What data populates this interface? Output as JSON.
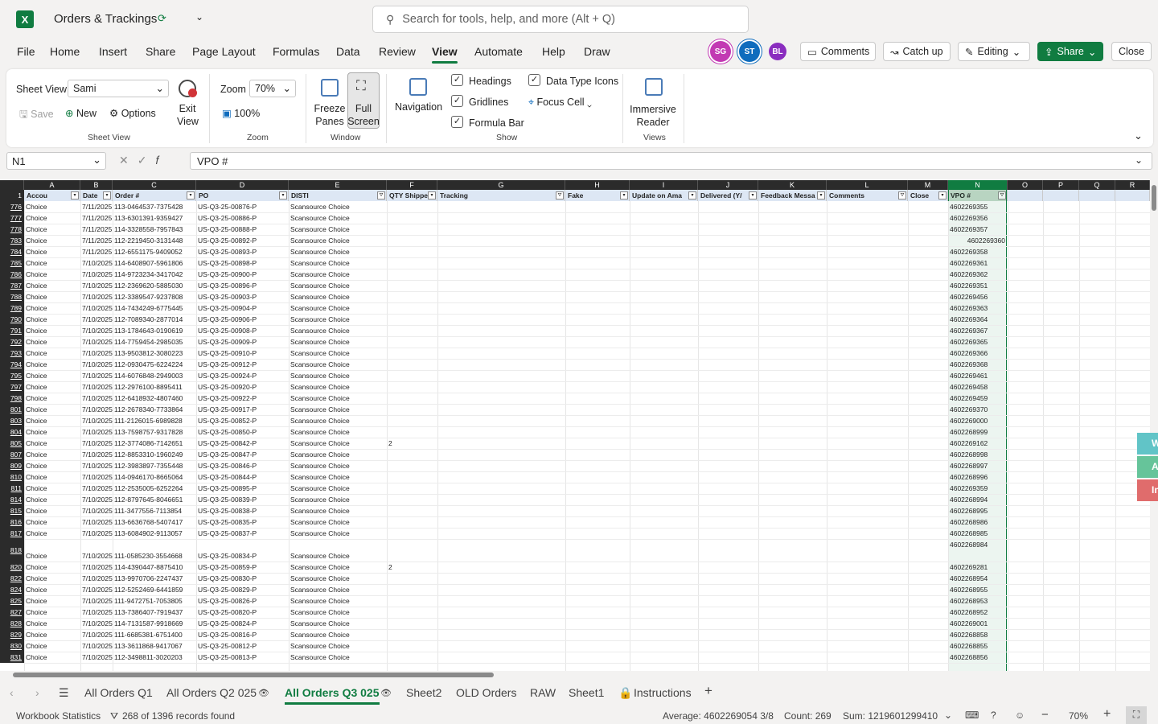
{
  "app": {
    "title": "Orders & Trackings",
    "search_placeholder": "Search for tools, help, and more (Alt + Q)",
    "logo": "X",
    "brand_color": "#107c41"
  },
  "menu": [
    "File",
    "Home",
    "Insert",
    "Share",
    "Page Layout",
    "Formulas",
    "Data",
    "Review",
    "View",
    "Automate",
    "Help",
    "Draw"
  ],
  "menu_active": "View",
  "avatars": [
    {
      "initials": "SG",
      "color": "#c239b3"
    },
    {
      "initials": "ST",
      "color": "#0f6cbd"
    },
    {
      "initials": "BL",
      "color": "#8a2dbf"
    }
  ],
  "top_buttons": {
    "comments": "Comments",
    "catchup": "Catch up",
    "editing": "Editing",
    "share": "Share",
    "close": "Close"
  },
  "ribbon": {
    "sheet_view_label": "Sheet View",
    "sheet_view_value": "Sami",
    "save": "Save",
    "new": "New",
    "options": "Options",
    "exit_view": "Exit View",
    "group_sheet_view": "Sheet View",
    "zoom_label": "Zoom",
    "zoom_value": "70%",
    "zoom_100": "100%",
    "group_zoom": "Zoom",
    "freeze": "Freeze Panes",
    "fullscreen": "Full Screen",
    "group_window": "Window",
    "navigation": "Navigation",
    "headings": "Headings",
    "gridlines": "Gridlines",
    "formula_bar": "Formula Bar",
    "data_type_icons": "Data Type Icons",
    "focus_cell": "Focus Cell",
    "group_show": "Show",
    "immersive": "Immersive Reader",
    "group_views": "Views"
  },
  "formula_bar": {
    "name_box": "N1",
    "content": "VPO #"
  },
  "columns": [
    "A",
    "B",
    "C",
    "D",
    "E",
    "F",
    "G",
    "H",
    "I",
    "J",
    "K",
    "L",
    "M",
    "N",
    "O",
    "P",
    "Q",
    "R"
  ],
  "headers": [
    "Accou",
    "Date",
    "Order #",
    "PO",
    "DISTI",
    "QTY Shippe",
    "Tracking",
    "Fake",
    "Update on Ama",
    "Delivered (Y/",
    "Feedback Messa",
    "Comments",
    "Close",
    "VPO #",
    "",
    "",
    "",
    ""
  ],
  "header_row_num": "1",
  "rows": [
    [
      "776",
      "Choice",
      "7/11/2025",
      "113-0464537-7375428",
      "US-Q3-25-00876-P",
      "Scansource Choice",
      "",
      "4602269355"
    ],
    [
      "777",
      "Choice",
      "7/11/2025",
      "113-6301391-9359427",
      "US-Q3-25-00886-P",
      "Scansource Choice",
      "",
      "4602269356"
    ],
    [
      "778",
      "Choice",
      "7/11/2025",
      "114-3328558-7957843",
      "US-Q3-25-00888-P",
      "Scansource Choice",
      "",
      "4602269357"
    ],
    [
      "783",
      "Choice",
      "7/11/2025",
      "112-2219450-3131448",
      "US-Q3-25-00892-P",
      "Scansource Choice",
      "",
      "4602269360"
    ],
    [
      "784",
      "Choice",
      "7/11/2025",
      "112-6551175-9409052",
      "US-Q3-25-00893-P",
      "Scansource Choice",
      "",
      "4602269358"
    ],
    [
      "785",
      "Choice",
      "7/10/2025",
      "114-6408907-5961806",
      "US-Q3-25-00898-P",
      "Scansource Choice",
      "",
      "4602269361"
    ],
    [
      "786",
      "Choice",
      "7/10/2025",
      "114-9723234-3417042",
      "US-Q3-25-00900-P",
      "Scansource Choice",
      "",
      "4602269362"
    ],
    [
      "787",
      "Choice",
      "7/10/2025",
      "112-2369620-5885030",
      "US-Q3-25-00896-P",
      "Scansource Choice",
      "",
      "4602269351"
    ],
    [
      "788",
      "Choice",
      "7/10/2025",
      "112-3389547-9237808",
      "US-Q3-25-00903-P",
      "Scansource Choice",
      "",
      "4602269456"
    ],
    [
      "789",
      "Choice",
      "7/10/2025",
      "114-7434249-6775445",
      "US-Q3-25-00904-P",
      "Scansource Choice",
      "",
      "4602269363"
    ],
    [
      "790",
      "Choice",
      "7/10/2025",
      "112-7089340-2877014",
      "US-Q3-25-00906-P",
      "Scansource Choice",
      "",
      "4602269364"
    ],
    [
      "791",
      "Choice",
      "7/10/2025",
      "113-1784643-0190619",
      "US-Q3-25-00908-P",
      "Scansource Choice",
      "",
      "4602269367"
    ],
    [
      "792",
      "Choice",
      "7/10/2025",
      "114-7759454-2985035",
      "US-Q3-25-00909-P",
      "Scansource Choice",
      "",
      "4602269365"
    ],
    [
      "793",
      "Choice",
      "7/10/2025",
      "113-9503812-3080223",
      "US-Q3-25-00910-P",
      "Scansource Choice",
      "",
      "4602269366"
    ],
    [
      "794",
      "Choice",
      "7/10/2025",
      "112-0930475-6224224",
      "US-Q3-25-00912-P",
      "Scansource Choice",
      "",
      "4602269368"
    ],
    [
      "795",
      "Choice",
      "7/10/2025",
      "114-6076848-2949003",
      "US-Q3-25-00924-P",
      "Scansource Choice",
      "",
      "4602269461"
    ],
    [
      "797",
      "Choice",
      "7/10/2025",
      "112-2976100-8895411",
      "US-Q3-25-00920-P",
      "Scansource Choice",
      "",
      "4602269458"
    ],
    [
      "798",
      "Choice",
      "7/10/2025",
      "112-6418932-4807460",
      "US-Q3-25-00922-P",
      "Scansource Choice",
      "",
      "4602269459"
    ],
    [
      "801",
      "Choice",
      "7/10/2025",
      "112-2678340-7733864",
      "US-Q3-25-00917-P",
      "Scansource Choice",
      "",
      "4602269370"
    ],
    [
      "803",
      "Choice",
      "7/10/2025",
      "111-2126015-6989828",
      "US-Q3-25-00852-P",
      "Scansource Choice",
      "",
      "4602269000"
    ],
    [
      "804",
      "Choice",
      "7/10/2025",
      "113-7598757-9317828",
      "US-Q3-25-00850-P",
      "Scansource Choice",
      "",
      "4602268999"
    ],
    [
      "805",
      "Choice",
      "7/10/2025",
      "112-3774086-7142651",
      "US-Q3-25-00842-P",
      "Scansource Choice",
      "2",
      "4602269162"
    ],
    [
      "807",
      "Choice",
      "7/10/2025",
      "112-8853310-1960249",
      "US-Q3-25-00847-P",
      "Scansource Choice",
      "",
      "4602268998"
    ],
    [
      "809",
      "Choice",
      "7/10/2025",
      "112-3983897-7355448",
      "US-Q3-25-00846-P",
      "Scansource Choice",
      "",
      "4602268997"
    ],
    [
      "810",
      "Choice",
      "7/10/2025",
      "114-0946170-8665064",
      "US-Q3-25-00844-P",
      "Scansource Choice",
      "",
      "4602268996"
    ],
    [
      "811",
      "Choice",
      "7/10/2025",
      "112-2535005-6252264",
      "US-Q3-25-00895-P",
      "Scansource Choice",
      "",
      "4602269359"
    ],
    [
      "814",
      "Choice",
      "7/10/2025",
      "112-8797645-8046651",
      "US-Q3-25-00839-P",
      "Scansource Choice",
      "",
      "4602268994"
    ],
    [
      "815",
      "Choice",
      "7/10/2025",
      "111-3477556-7113854",
      "US-Q3-25-00838-P",
      "Scansource Choice",
      "",
      "4602268995"
    ],
    [
      "816",
      "Choice",
      "7/10/2025",
      "113-6636768-5407417",
      "US-Q3-25-00835-P",
      "Scansource Choice",
      "",
      "4602268986"
    ],
    [
      "817",
      "Choice",
      "7/10/2025",
      "113-6084902-9113057",
      "US-Q3-25-00837-P",
      "Scansource Choice",
      "",
      "4602268985"
    ],
    [
      "818",
      "Choice",
      "7/10/2025",
      "111-0585230-3554668",
      "US-Q3-25-00834-P",
      "Scansource Choice",
      "",
      "4602268984"
    ],
    [
      "820",
      "Choice",
      "7/10/2025",
      "114-4390447-8875410",
      "US-Q3-25-00859-P",
      "Scansource Choice",
      "2",
      "4602269281"
    ],
    [
      "822",
      "Choice",
      "7/10/2025",
      "113-9970706-2247437",
      "US-Q3-25-00830-P",
      "Scansource Choice",
      "",
      "4602268954"
    ],
    [
      "824",
      "Choice",
      "7/10/2025",
      "112-5252469-6441859",
      "US-Q3-25-00829-P",
      "Scansource Choice",
      "",
      "4602268955"
    ],
    [
      "825",
      "Choice",
      "7/10/2025",
      "111-9472751-7053805",
      "US-Q3-25-00826-P",
      "Scansource Choice",
      "",
      "4602268953"
    ],
    [
      "827",
      "Choice",
      "7/10/2025",
      "113-7386407-7919437",
      "US-Q3-25-00820-P",
      "Scansource Choice",
      "",
      "4602268952"
    ],
    [
      "828",
      "Choice",
      "7/10/2025",
      "114-7131587-9918669",
      "US-Q3-25-00824-P",
      "Scansource Choice",
      "",
      "4602269001"
    ],
    [
      "829",
      "Choice",
      "7/10/2025",
      "111-6685381-6751400",
      "US-Q3-25-00816-P",
      "Scansource Choice",
      "",
      "4602268858"
    ],
    [
      "830",
      "Choice",
      "7/10/2025",
      "113-3611868-9417067",
      "US-Q3-25-00812-P",
      "Scansource Choice",
      "",
      "4602268855"
    ],
    [
      "831",
      "Choice",
      "7/10/2025",
      "112-3498811-3020203",
      "US-Q3-25-00813-P",
      "Scansource Choice",
      "",
      "4602268856"
    ]
  ],
  "sheet_tabs": [
    "All Orders Q1",
    "All Orders Q2 025",
    "All Orders Q3 025",
    "Sheet2",
    "OLD Orders",
    "RAW",
    "Sheet1",
    "Instructions"
  ],
  "active_tab": "All Orders Q3 025",
  "status": {
    "workbook_stats": "Workbook Statistics",
    "records": "268 of 1396 records found",
    "average": "Average: 4602269054 3/8",
    "count": "Count: 269",
    "sum": "Sum: 1219601299410",
    "zoom": "70%"
  },
  "side_panel": [
    "W",
    "Ac",
    "In"
  ]
}
